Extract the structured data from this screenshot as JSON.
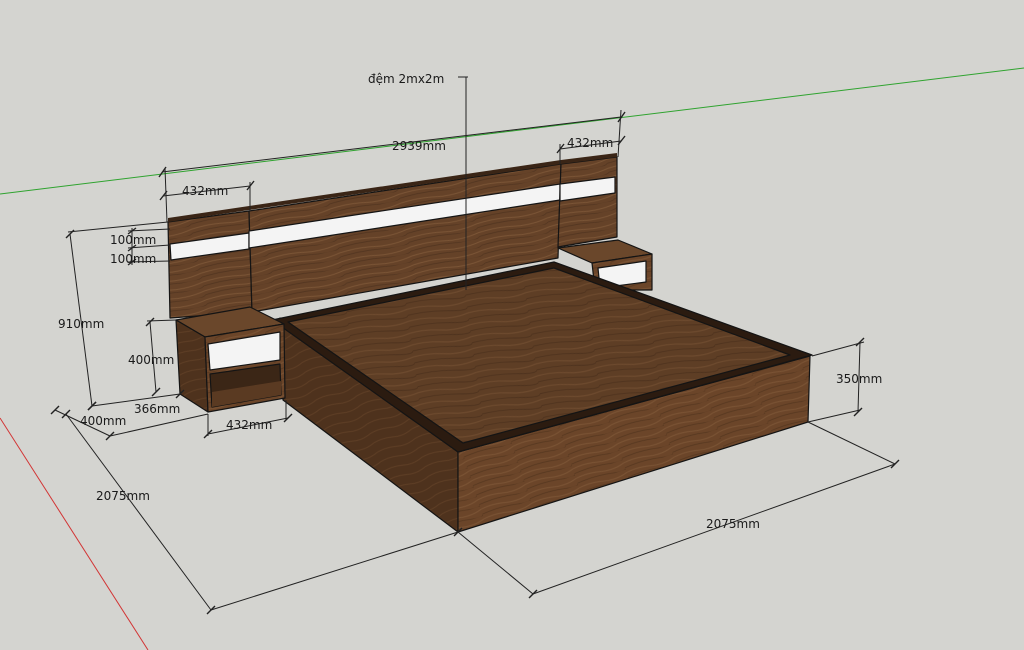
{
  "scene": {
    "colors": {
      "background": "#d4d4d0",
      "axis_green": "#2fa32f",
      "axis_red": "#d23434",
      "wood_top": "#5e3e25",
      "wood_front": "#6b4529",
      "wood_side": "#4e321d",
      "panel_white": "#f4f4f4",
      "dimension_line": "#222222"
    }
  },
  "annotations": {
    "mattress_note": "đệm 2mx2m",
    "headboard_width": "2939mm",
    "side_panel_width_left": "432mm",
    "side_panel_width_right": "432mm",
    "strip_height_top": "100mm",
    "strip_height_bottom": "100mm",
    "total_height": "910mm",
    "nightstand_height": "400mm",
    "nightstand_offset": "366mm",
    "nightstand_depth": "400mm",
    "nightstand_width": "432mm",
    "bed_length": "2075mm",
    "bed_width": "2075mm",
    "bed_height": "350mm"
  }
}
